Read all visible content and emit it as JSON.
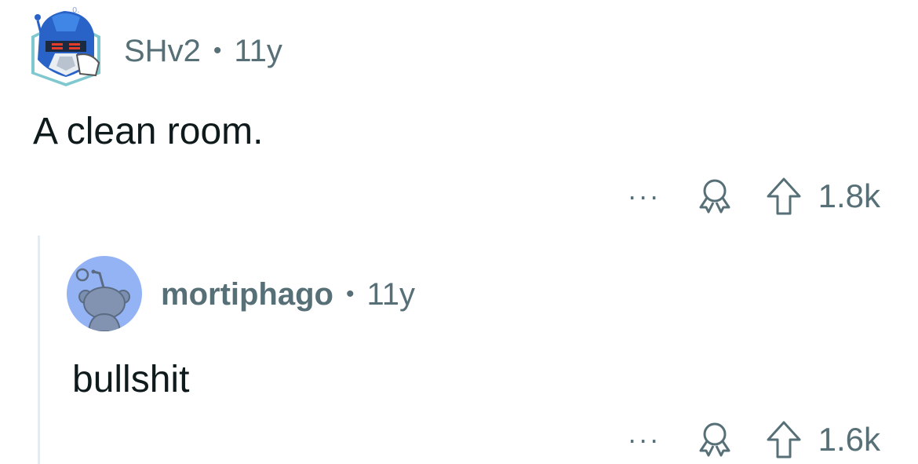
{
  "comments": [
    {
      "author": "SHv2",
      "separator": "•",
      "age": "11y",
      "body": "A clean room.",
      "more": "···",
      "score": "1.8k",
      "avatar_icon": "robot-avatar-icon"
    },
    {
      "author": "mortiphago",
      "separator": "•",
      "age": "11y",
      "body": "bullshit",
      "more": "···",
      "score": "1.6k",
      "avatar_icon": "snoo-avatar-icon"
    }
  ],
  "colors": {
    "meta_text": "#576f76",
    "body_text": "#0f1a1c",
    "thread_line": "#e5ebee",
    "snoo_bg": "#94b3f5"
  }
}
